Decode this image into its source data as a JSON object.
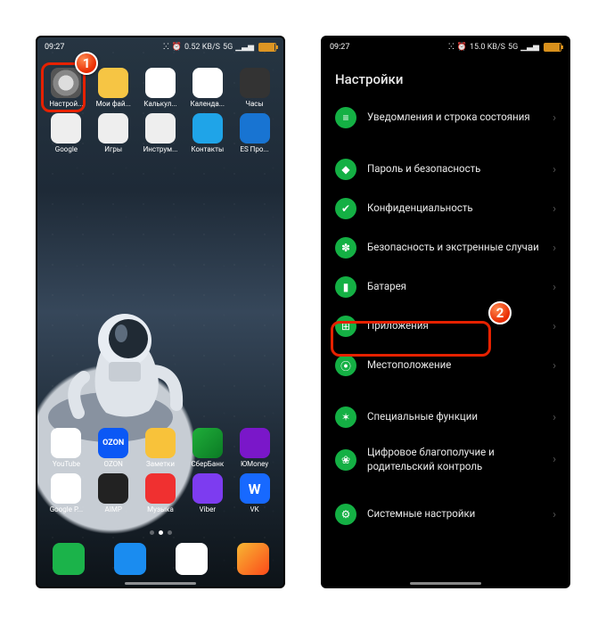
{
  "left": {
    "status": {
      "time": "09:27",
      "net": "0.52 KB/S",
      "sig": "5G",
      "batt": "97"
    },
    "apps_row1": [
      {
        "label": "Настрой...",
        "icon": "ic-settings",
        "name": "app-settings"
      },
      {
        "label": "Мои фай...",
        "icon": "ic-files",
        "name": "app-files"
      },
      {
        "label": "Калькул...",
        "icon": "ic-calc",
        "name": "app-calculator"
      },
      {
        "label": "Календа...",
        "icon": "ic-calendar",
        "name": "app-calendar"
      },
      {
        "label": "Часы",
        "icon": "ic-clock",
        "name": "app-clock"
      }
    ],
    "apps_row2": [
      {
        "label": "Google",
        "icon": "ic-google",
        "name": "app-google-folder"
      },
      {
        "label": "Игры",
        "icon": "ic-games",
        "name": "app-games-folder"
      },
      {
        "label": "Инструм...",
        "icon": "ic-tools",
        "name": "app-tools-folder"
      },
      {
        "label": "Контакты",
        "icon": "ic-contacts",
        "name": "app-contacts"
      },
      {
        "label": "ES Про...",
        "icon": "ic-es",
        "name": "app-es-explorer"
      }
    ],
    "apps_row3": [
      {
        "label": "YouTube",
        "icon": "ic-youtube",
        "name": "app-youtube"
      },
      {
        "label": "OZON",
        "icon": "ic-ozon",
        "name": "app-ozon",
        "text": "OZON"
      },
      {
        "label": "Заметки",
        "icon": "ic-notes",
        "name": "app-notes"
      },
      {
        "label": "СберБанк",
        "icon": "ic-sber",
        "name": "app-sberbank"
      },
      {
        "label": "ЮMoney",
        "icon": "ic-umoney",
        "name": "app-umoney"
      }
    ],
    "apps_row4": [
      {
        "label": "Google P...",
        "icon": "ic-play",
        "name": "app-play-store"
      },
      {
        "label": "AIMP",
        "icon": "ic-aimp",
        "name": "app-aimp"
      },
      {
        "label": "Музыка",
        "icon": "ic-music",
        "name": "app-music"
      },
      {
        "label": "Viber",
        "icon": "ic-viber",
        "name": "app-viber"
      },
      {
        "label": "VK",
        "icon": "ic-vk",
        "name": "app-vk",
        "text": "W"
      }
    ],
    "dock": [
      {
        "icon": "ic-phone",
        "name": "dock-phone"
      },
      {
        "icon": "ic-sms",
        "name": "dock-messages"
      },
      {
        "icon": "ic-yandex",
        "name": "dock-yandex"
      },
      {
        "icon": "ic-camera",
        "name": "dock-camera"
      }
    ],
    "callout": "1"
  },
  "right": {
    "status": {
      "time": "09:27",
      "net": "15.0 KB/S",
      "sig": "5G",
      "batt": "97"
    },
    "title": "Настройки",
    "items": [
      {
        "label": "Уведомления и строка состояния",
        "name": "settings-notifications",
        "glyph": "≡"
      },
      {
        "gap": true
      },
      {
        "label": "Пароль и безопасность",
        "name": "settings-password",
        "glyph": "◆"
      },
      {
        "label": "Конфиденциальность",
        "name": "settings-privacy",
        "glyph": "✔"
      },
      {
        "label": "Безопасность и экстренные случаи",
        "name": "settings-emergency",
        "glyph": "✽"
      },
      {
        "label": "Батарея",
        "name": "settings-battery",
        "glyph": "▮"
      },
      {
        "label": "Приложения",
        "name": "settings-apps",
        "glyph": "⊞",
        "highlight": true
      },
      {
        "label": "Местоположение",
        "name": "settings-location",
        "glyph": "⦿"
      },
      {
        "gap": true
      },
      {
        "label": "Специальные функции",
        "name": "settings-special",
        "glyph": "✶"
      },
      {
        "label": "Цифровое благополучие и родительский контроль",
        "name": "settings-wellbeing",
        "glyph": "❀"
      },
      {
        "gap": true
      },
      {
        "label": "Системные настройки",
        "name": "settings-system",
        "glyph": "⚙"
      }
    ],
    "callout": "2"
  }
}
